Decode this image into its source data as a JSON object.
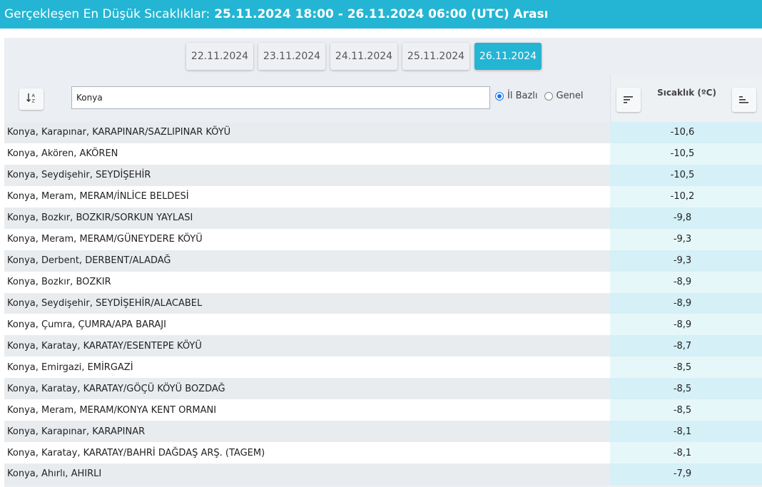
{
  "header": {
    "title_prefix": "Gerçekleşen En Düşük Sıcaklıklar:",
    "title_range": "25.11.2024 18:00 - 26.11.2024 06:00 (UTC) Arası"
  },
  "date_tabs": [
    {
      "label": "22.11.2024",
      "active": false
    },
    {
      "label": "23.11.2024",
      "active": false
    },
    {
      "label": "24.11.2024",
      "active": false
    },
    {
      "label": "25.11.2024",
      "active": false
    },
    {
      "label": "26.11.2024",
      "active": true
    }
  ],
  "search": {
    "value": "Konya"
  },
  "radio": {
    "il_bazli": "İl Bazlı",
    "genel": "Genel",
    "selected": "il_bazli"
  },
  "temp_column": {
    "title": "Sıcaklık (ºC)"
  },
  "icons": {
    "sort_alpha": "sort-alpha-icon",
    "sort_desc": "sort-desc-icon",
    "sort_asc": "sort-asc-icon"
  },
  "colors": {
    "accent": "#23b5d3",
    "radio": "#1a73e8"
  },
  "rows": [
    {
      "name": "Konya, Karapınar, KARAPINAR/SAZLIPINAR KÖYÜ",
      "temp": "-10,6"
    },
    {
      "name": "Konya, Akören, AKÖREN",
      "temp": "-10,5"
    },
    {
      "name": "Konya, Seydişehir, SEYDİŞEHİR",
      "temp": "-10,5"
    },
    {
      "name": "Konya, Meram, MERAM/İNLİCE BELDESİ",
      "temp": "-10,2"
    },
    {
      "name": "Konya, Bozkır, BOZKIR/SORKUN YAYLASI",
      "temp": "-9,8"
    },
    {
      "name": "Konya, Meram, MERAM/GÜNEYDERE KÖYÜ",
      "temp": "-9,3"
    },
    {
      "name": "Konya, Derbent, DERBENT/ALADAĞ",
      "temp": "-9,3"
    },
    {
      "name": "Konya, Bozkır, BOZKIR",
      "temp": "-8,9"
    },
    {
      "name": "Konya, Seydişehir, SEYDİŞEHİR/ALACABEL",
      "temp": "-8,9"
    },
    {
      "name": "Konya, Çumra, ÇUMRA/APA BARAJI",
      "temp": "-8,9"
    },
    {
      "name": "Konya, Karatay, KARATAY/ESENTEPE KÖYÜ",
      "temp": "-8,7"
    },
    {
      "name": "Konya, Emirgazi, EMİRGAZİ",
      "temp": "-8,5"
    },
    {
      "name": "Konya, Karatay, KARATAY/GÖÇÜ KÖYÜ BOZDAĞ",
      "temp": "-8,5"
    },
    {
      "name": "Konya, Meram, MERAM/KONYA KENT ORMANI",
      "temp": "-8,5"
    },
    {
      "name": "Konya, Karapınar, KARAPINAR",
      "temp": "-8,1"
    },
    {
      "name": "Konya, Karatay, KARATAY/BAHRİ DAĞDAŞ ARŞ. (TAGEM)",
      "temp": "-8,1"
    },
    {
      "name": "Konya, Ahırlı, AHIRLI",
      "temp": "-7,9"
    }
  ]
}
